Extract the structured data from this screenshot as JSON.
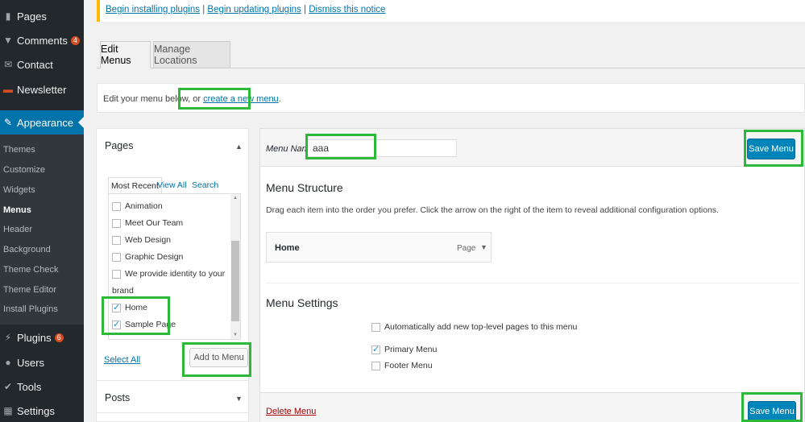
{
  "sidebar": {
    "items": [
      {
        "label": "Pages",
        "icon": "pages-icon"
      },
      {
        "label": "Comments",
        "badge": "4",
        "icon": "comments-icon"
      },
      {
        "label": "Contact",
        "icon": "contact-icon"
      },
      {
        "label": "Newsletter",
        "icon": "newsletter-icon"
      },
      {
        "label": "Appearance",
        "icon": "appearance-icon"
      },
      {
        "label": "Plugins",
        "badge": "6",
        "icon": "plugins-icon"
      },
      {
        "label": "Users",
        "icon": "users-icon"
      },
      {
        "label": "Tools",
        "icon": "tools-icon"
      },
      {
        "label": "Settings",
        "icon": "settings-icon"
      }
    ],
    "submenu": [
      "Themes",
      "Customize",
      "Widgets",
      "Menus",
      "Header",
      "Background",
      "Theme Check",
      "Theme Editor",
      "Install Plugins"
    ]
  },
  "notice": {
    "link1": "Begin installing plugins",
    "sep1": "|",
    "link2": "Begin updating plugins",
    "sep2": "|",
    "link3": "Dismiss this notice"
  },
  "tabs": {
    "edit": "Edit Menus",
    "manage": "Manage Locations"
  },
  "intro": {
    "text": "Edit your menu below, or ",
    "link": "create a new menu",
    "end": "."
  },
  "left": {
    "pages_title": "Pages",
    "tabs": [
      "Most Recent",
      "View All",
      "Search"
    ],
    "pages": [
      {
        "label": "Animation",
        "checked": false
      },
      {
        "label": "Meet Our Team",
        "checked": false
      },
      {
        "label": "Web Design",
        "checked": false
      },
      {
        "label": "Graphic Design",
        "checked": false
      },
      {
        "label": "We provide identity to your",
        "checked": false
      },
      {
        "label": "brand",
        "checked": false
      },
      {
        "label": "Home",
        "checked": true
      },
      {
        "label": "Sample Page",
        "checked": true
      }
    ],
    "select_all": "Select All",
    "add_button": "Add to Menu",
    "posts_title": "Posts"
  },
  "right": {
    "menu_name_label": "Menu Name",
    "menu_name_value": "aaa",
    "save_label": "Save Menu",
    "structure_title": "Menu Structure",
    "structure_desc": "Drag each item into the order you prefer. Click the arrow on the right of the item to reveal additional configuration options.",
    "menu_item_title": "Home",
    "menu_item_type": "Page",
    "settings_title": "Menu Settings",
    "auto_add": "Automatically add new top-level pages to this menu",
    "primary": "Primary Menu",
    "footer": "Footer Menu",
    "delete": "Delete Menu"
  },
  "colors": {
    "accent": "#0073aa",
    "button": "#0085ba",
    "highlight": "#2eb83a",
    "sidebar": "#23282d"
  }
}
